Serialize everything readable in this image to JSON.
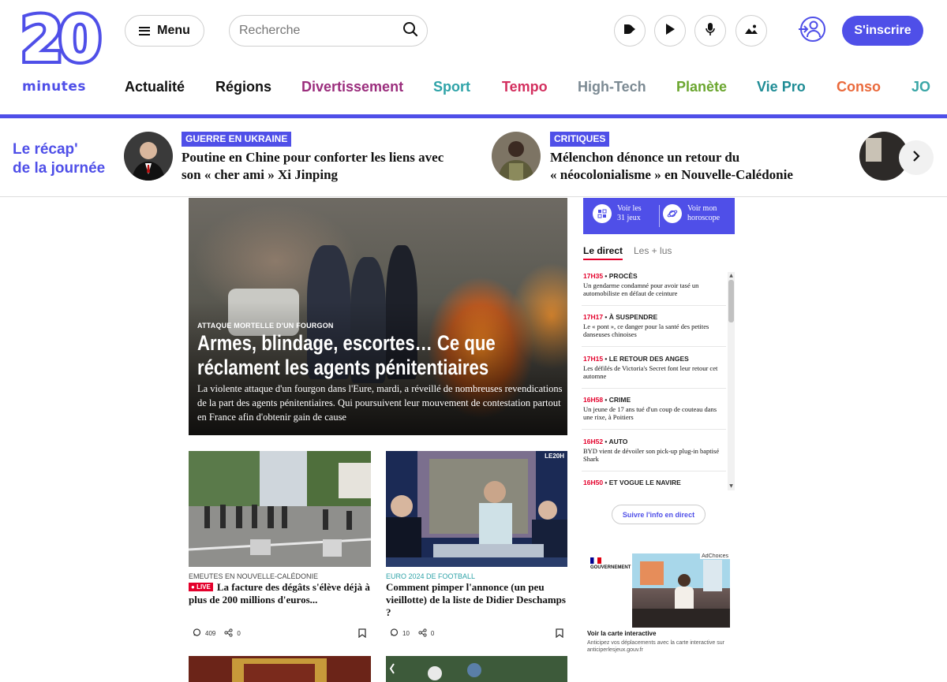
{
  "header": {
    "logo_number": "20",
    "logo_word": "minutes",
    "menu_label": "Menu",
    "search_placeholder": "Recherche",
    "signup_label": "S'inscrire",
    "brand_color": "#4f4fe8"
  },
  "nav": [
    {
      "label": "Actualité",
      "color": "#111111"
    },
    {
      "label": "Régions",
      "color": "#111111"
    },
    {
      "label": "Divertissement",
      "color": "#9b2e7d"
    },
    {
      "label": "Sport",
      "color": "#2fa3a8"
    },
    {
      "label": "Tempo",
      "color": "#d3305f"
    },
    {
      "label": "High-Tech",
      "color": "#7c8a93"
    },
    {
      "label": "Planète",
      "color": "#6ba62f"
    },
    {
      "label": "Vie Pro",
      "color": "#1f8c95"
    },
    {
      "label": "Conso",
      "color": "#ea6a3c"
    },
    {
      "label": "JO",
      "color": "#3aa6a6"
    }
  ],
  "recap": {
    "title_line1": "Le récap'",
    "title_line2": "de la journée",
    "items": [
      {
        "tag": "GUERRE EN UKRAINE",
        "line1": "Poutine en Chine pour conforter les liens avec",
        "line2": "son « cher ami » Xi Jinping"
      },
      {
        "tag": "CRITIQUES",
        "line1": "Mélenchon dénonce un retour du",
        "line2": "« néocolonialisme » en Nouvelle-Calédonie"
      }
    ]
  },
  "hero": {
    "kicker": "ATTAQUE MORTELLE D'UN FOURGON",
    "title": "Armes, blindage, escortes… Ce que réclament les agents pénitentiaires",
    "summary": "La violente attaque d'un fourgon dans l'Eure, mardi, a réveillé de nombreuses revendications de la part des agents pénitentiaires. Qui poursuivent leur mouvement de contestation partout en France afin d'obtenir gain de cause"
  },
  "cards": [
    {
      "kicker": "EMEUTES EN NOUVELLE-CALÉDONIE",
      "live": "LIVE",
      "title": "La facture des dégâts s'élève déjà à plus de 200 millions d'euros...",
      "comments": "409",
      "shares": "0"
    },
    {
      "kicker": "EURO 2024 DE FOOTBALL",
      "live": "",
      "title": "Comment pimper l'annonce (un peu vieillotte) de la liste de Didier Deschamps ?",
      "comments": "10",
      "shares": "0",
      "watermark": "LE20H"
    }
  ],
  "sidebar": {
    "cta_games": "Voir les 31 jeux",
    "cta_horoscope": "Voir mon horoscope",
    "tab_live": "Le direct",
    "tab_most_read": "Les + lus",
    "live_items": [
      {
        "time": "17H35",
        "category": "PROCÈS",
        "text": "Un gendarme condamné pour avoir tasé un automobiliste en défaut de ceinture"
      },
      {
        "time": "17H17",
        "category": "À SUSPENDRE",
        "text": "Le « pont », ce danger pour la santé des petites danseuses chinoises"
      },
      {
        "time": "17H15",
        "category": "LE RETOUR DES ANGES",
        "text": "Les défilés de Victoria's Secret font leur retour cet automne"
      },
      {
        "time": "16H58",
        "category": "CRIME",
        "text": "Un jeune de 17 ans tué d'un coup de couteau dans une rixe, à Poitiers"
      },
      {
        "time": "16H52",
        "category": "AUTO",
        "text": "BYD vient de dévoiler son pick-up plug-in baptisé Shark"
      },
      {
        "time": "16H50",
        "category": "ET VOGUE LE NAVIRE",
        "text": ""
      }
    ],
    "follow_label": "Suivre l'info en direct",
    "ad": {
      "choices": "AdChoices",
      "gov": "GOUVERNEMENT",
      "title": "Voir la carte interactive",
      "text": "Anticipez vos déplacements avec la carte interactive sur anticiperlesjeux.gouv.fr"
    }
  }
}
